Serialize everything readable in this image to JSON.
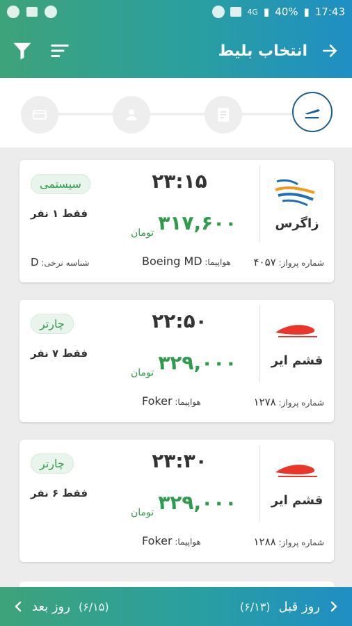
{
  "status_bar": {
    "battery": "40%",
    "time": "17:43",
    "network": "4G"
  },
  "app_bar": {
    "title": "انتخاب بلیط"
  },
  "flights": [
    {
      "airline": "زاگرس",
      "time": "۲۳:۱۵",
      "price": "۳۱۷,۶۰۰",
      "currency": "تومان",
      "type_badge": "سیستمی",
      "seats": "فقط ۱ نفر",
      "flight_no_label": "شماره پرواز:",
      "flight_no": "۴۰۵۷",
      "aircraft_label": "هواپیما:",
      "aircraft": "Boeing MD",
      "fare_id_label": "شناسه نرخی:",
      "fare_id": "D"
    },
    {
      "airline": "قشم ایر",
      "time": "۲۲:۵۰",
      "price": "۳۲۹,۰۰۰",
      "currency": "تومان",
      "type_badge": "چارتر",
      "seats": "فقط ۷ نفر",
      "flight_no_label": "شماره پرواز:",
      "flight_no": "۱۲۷۸",
      "aircraft_label": "هواپیما:",
      "aircraft": "Foker"
    },
    {
      "airline": "قشم ایر",
      "time": "۲۳:۳۰",
      "price": "۳۲۹,۰۰۰",
      "currency": "تومان",
      "type_badge": "چارتر",
      "seats": "فقط ۶ نفر",
      "flight_no_label": "شماره پرواز:",
      "flight_no": "۱۲۸۸",
      "aircraft_label": "هواپیما:",
      "aircraft": "Foker"
    }
  ],
  "bottom_nav": {
    "prev_label": "روز قبل",
    "prev_date": "(۶/۱۳)",
    "next_label": "روز بعد",
    "next_date": "(۶/۱۵)"
  },
  "colors": {
    "brand_start": "#3ea37a",
    "brand_end": "#1f8fc4",
    "price": "#2f9b4d",
    "step_active": "#1d5d8c"
  }
}
